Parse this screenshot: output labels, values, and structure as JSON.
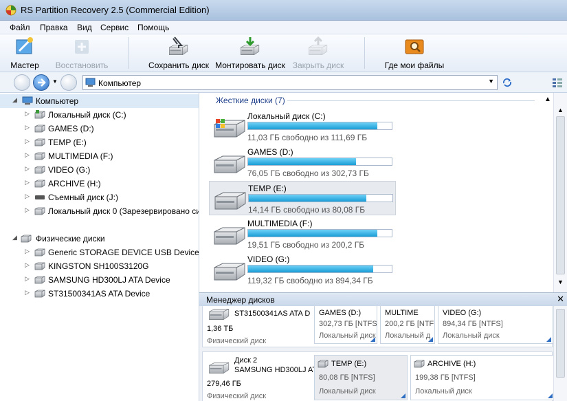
{
  "window": {
    "title": "RS Partition Recovery 2.5 (Commercial Edition)"
  },
  "menu": [
    "Файл",
    "Правка",
    "Вид",
    "Сервис",
    "Помощь"
  ],
  "toolbar": {
    "wizard": "Мастер",
    "restore": "Восстановить",
    "save_disk": "Сохранить диск",
    "mount_disk": "Монтировать диск",
    "close_disk": "Закрыть диск",
    "where_files": "Где мои файлы"
  },
  "address": {
    "value": "Компьютер"
  },
  "tree": {
    "root": "Компьютер",
    "drives": [
      "Локальный диск (C:)",
      "GAMES (D:)",
      "TEMP (E:)",
      "MULTIMEDIA (F:)",
      "VIDEO (G:)",
      "ARCHIVE (H:)",
      "Съемный диск (J:)",
      "Локальный диск 0 (Зарезервировано си"
    ],
    "physical_root": "Физические диски",
    "physical": [
      "Generic STORAGE DEVICE USB Device",
      "KINGSTON SH100S3120G",
      "SAMSUNG HD300LJ ATA Device",
      "ST31500341AS ATA Device"
    ]
  },
  "hard_disks": {
    "header": "Жесткие диски (7)",
    "items": [
      {
        "name": "Локальный диск (C:)",
        "free": "11,03 ГБ свободно из 111,69 ГБ",
        "used_fraction": 0.9
      },
      {
        "name": "GAMES (D:)",
        "free": "76,05 ГБ свободно из 302,73 ГБ",
        "used_fraction": 0.75
      },
      {
        "name": "TEMP (E:)",
        "free": "14,14 ГБ свободно из 80,08 ГБ",
        "used_fraction": 0.82
      },
      {
        "name": "MULTIMEDIA (F:)",
        "free": "19,51 ГБ свободно из 200,2 ГБ",
        "used_fraction": 0.9
      },
      {
        "name": "VIDEO (G:)",
        "free": "119,32 ГБ свободно из 894,34 ГБ",
        "used_fraction": 0.87
      }
    ]
  },
  "disk_manager": {
    "title": "Менеджер дисков",
    "disk1": {
      "model": "ST31500341AS ATA D",
      "size": "1,36 ТБ",
      "type": "Физический диск",
      "parts": [
        {
          "name": "GAMES (D:)",
          "size": "302,73 ГБ [NTFS]",
          "type": "Локальный диск"
        },
        {
          "name": "MULTIME",
          "size": "200,2 ГБ [NTFS]",
          "type": "Локальный д"
        },
        {
          "name": "VIDEO (G:)",
          "size": "894,34 ГБ [NTFS]",
          "type": "Локальный диск"
        }
      ]
    },
    "disk2": {
      "label": "Диск 2",
      "model": "SAMSUNG HD300LJ AT",
      "size": "279,46 ГБ",
      "type": "Физический диск",
      "parts": [
        {
          "name": "TEMP (E:)",
          "size": "80,08 ГБ [NTFS]",
          "type": "Локальный диск"
        },
        {
          "name": "ARCHIVE (H:)",
          "size": "199,38 ГБ [NTFS]",
          "type": "Локальный диск"
        }
      ]
    }
  },
  "colors": {
    "accent": "#1a9dd6",
    "group_header": "#1e3f8a",
    "selection": "#dce9f7"
  }
}
